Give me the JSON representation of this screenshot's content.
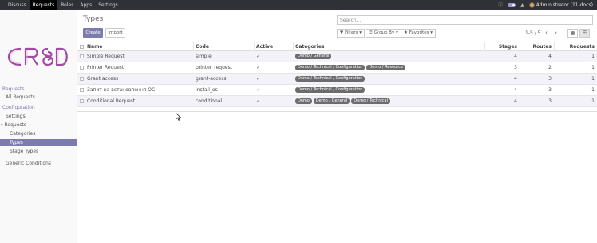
{
  "topbar": {
    "menu": [
      "Discuss",
      "Requests",
      "Roles",
      "Apps",
      "Settings"
    ],
    "active_menu": "Requests",
    "user": "Administrator (11-docs)",
    "colors": {
      "bar": "#2f3136",
      "accent": "#7c7bad"
    }
  },
  "sidebar": {
    "logo_text": "CR8D",
    "section_requests": "Requests",
    "all_requests": "All Requests",
    "section_configuration": "Configuration",
    "settings": "Settings",
    "requests_group": "Requests",
    "categories": "Categories",
    "types": "Types",
    "stage_types": "Stage Types",
    "generic_conditions": "Generic Conditions"
  },
  "main": {
    "title": "Types",
    "create_label": "Create",
    "import_label": "Import",
    "search_placeholder": "Search...",
    "filters_label": "Filters",
    "groupby_label": "Group By",
    "favorites_label": "Favorites",
    "pager": "1-5 / 5"
  },
  "table": {
    "headers": {
      "name": "Name",
      "code": "Code",
      "active": "Active",
      "categories": "Categories",
      "stages": "Stages",
      "routes": "Routes",
      "requests": "Requests"
    },
    "rows": [
      {
        "name": "Simple Request",
        "code": "simple",
        "active": true,
        "categories": [
          "Demo / General"
        ],
        "stages": "4",
        "routes": "4",
        "requests": "1"
      },
      {
        "name": "Printer Request",
        "code": "printer_request",
        "active": true,
        "categories": [
          "Demo / Technical / Configuration",
          "Demo / Resource"
        ],
        "stages": "3",
        "routes": "2",
        "requests": "1"
      },
      {
        "name": "Grant access",
        "code": "grant-access",
        "active": true,
        "categories": [
          "Demo / Technical / Configuration"
        ],
        "stages": "4",
        "routes": "3",
        "requests": "1"
      },
      {
        "name": "Запит на встановлення ОС",
        "code": "install_os",
        "active": true,
        "categories": [
          "Demo / Technical / Configuration"
        ],
        "stages": "4",
        "routes": "3",
        "requests": "1"
      },
      {
        "name": "Conditional Request",
        "code": "conditional",
        "active": true,
        "categories": [
          "Demo",
          "Demo / General",
          "Demo / Technical"
        ],
        "stages": "4",
        "routes": "3",
        "requests": "1"
      }
    ]
  }
}
